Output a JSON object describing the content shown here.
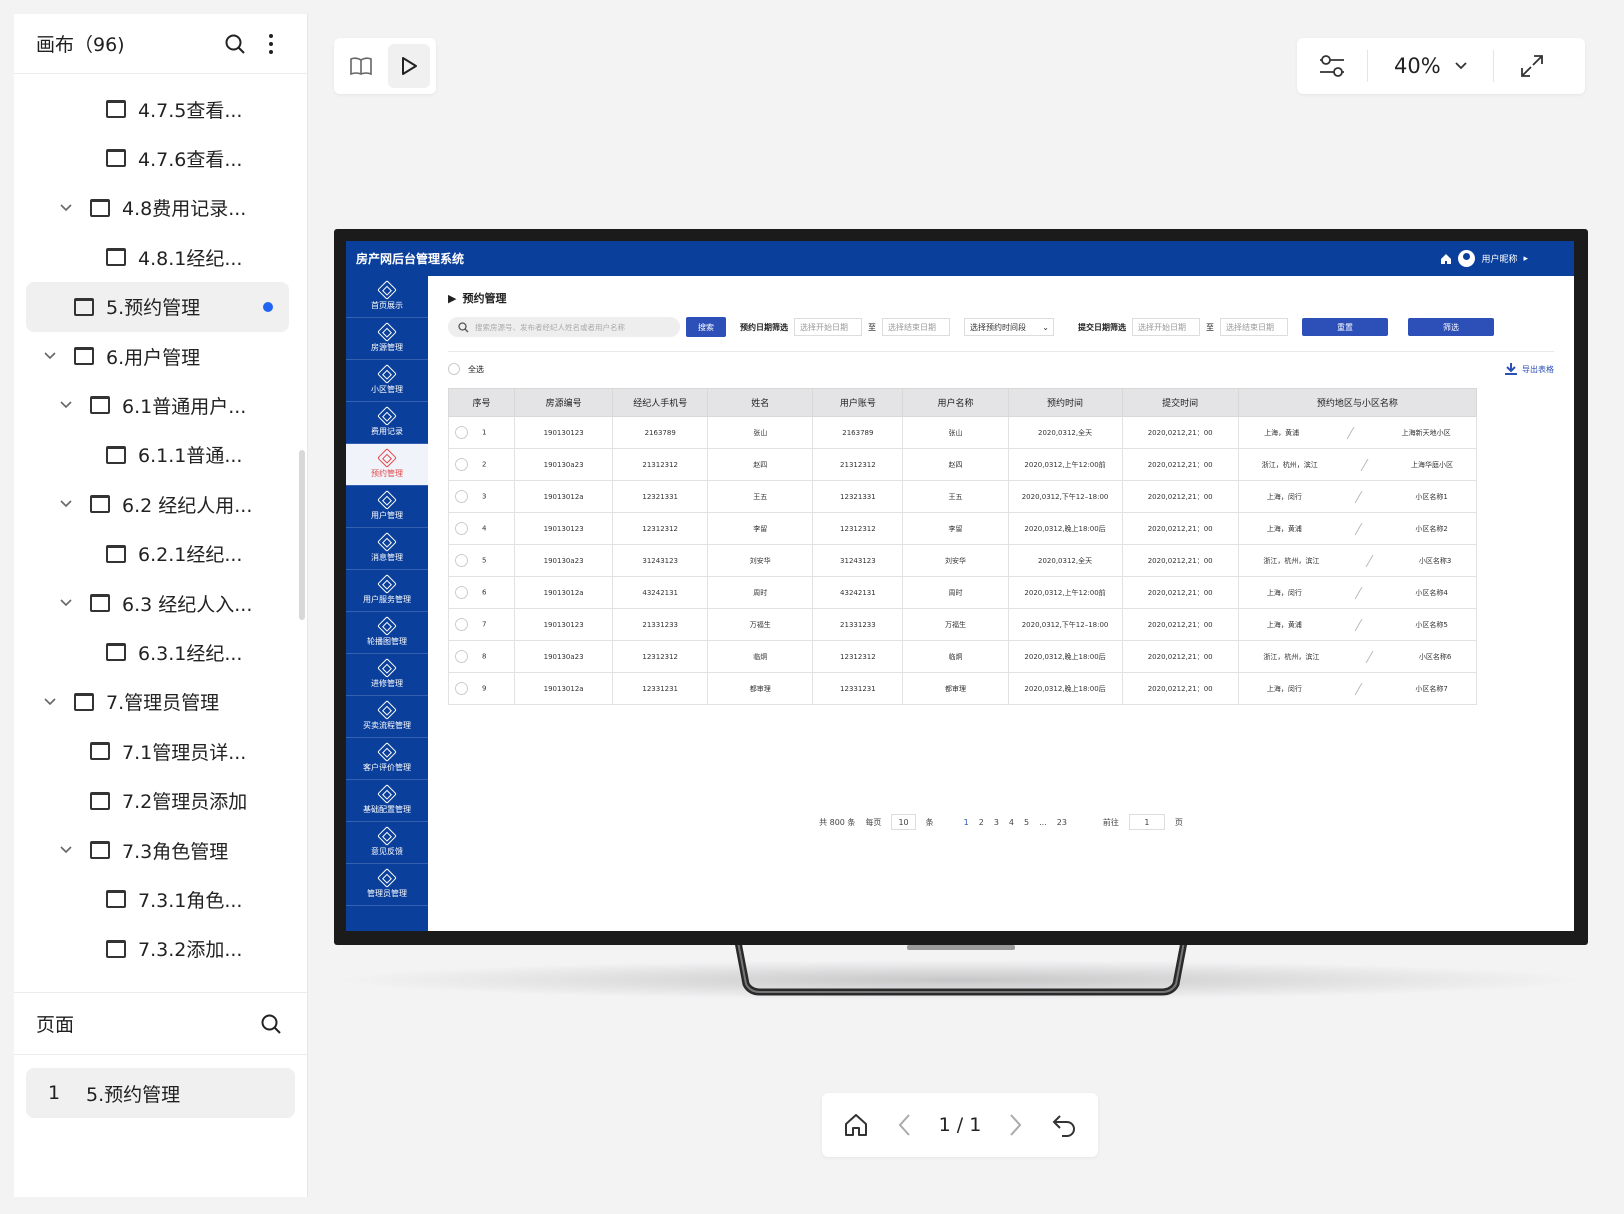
{
  "canvas": {
    "title": "画布（96)"
  },
  "tree": [
    {
      "label": "4.7.5查看...",
      "indent": 2,
      "chevron": false,
      "active": false
    },
    {
      "label": "4.7.6查看...",
      "indent": 2,
      "chevron": false,
      "active": false
    },
    {
      "label": "4.8费用记录...",
      "indent": 1,
      "chevron": true,
      "active": false
    },
    {
      "label": "4.8.1经纪...",
      "indent": 2,
      "chevron": false,
      "active": false
    },
    {
      "label": "5.预约管理",
      "indent": 0,
      "chevron": false,
      "active": true
    },
    {
      "label": "6.用户管理",
      "indent": 0,
      "chevron": true,
      "active": false
    },
    {
      "label": "6.1普通用户...",
      "indent": 1,
      "chevron": true,
      "active": false
    },
    {
      "label": "6.1.1普通...",
      "indent": 2,
      "chevron": false,
      "active": false
    },
    {
      "label": "6.2 经纪人用...",
      "indent": 1,
      "chevron": true,
      "active": false
    },
    {
      "label": "6.2.1经纪...",
      "indent": 2,
      "chevron": false,
      "active": false
    },
    {
      "label": "6.3 经纪人入...",
      "indent": 1,
      "chevron": true,
      "active": false
    },
    {
      "label": "6.3.1经纪...",
      "indent": 2,
      "chevron": false,
      "active": false
    },
    {
      "label": "7.管理员管理",
      "indent": 0,
      "chevron": true,
      "active": false
    },
    {
      "label": "7.1管理员详...",
      "indent": 1,
      "chevron": false,
      "active": false
    },
    {
      "label": "7.2管理员添加",
      "indent": 1,
      "chevron": false,
      "active": false
    },
    {
      "label": "7.3角色管理",
      "indent": 1,
      "chevron": true,
      "active": false
    },
    {
      "label": "7.3.1角色...",
      "indent": 2,
      "chevron": false,
      "active": false
    },
    {
      "label": "7.3.2添加...",
      "indent": 2,
      "chevron": false,
      "active": false
    }
  ],
  "pages": {
    "title": "页面",
    "items": [
      {
        "num": "1",
        "label": "5.预约管理"
      }
    ]
  },
  "toolbar": {
    "zoom": "40%"
  },
  "pager_nav": {
    "text": "1 / 1"
  },
  "app": {
    "title": "房产网后台管理系统",
    "user": "用户昵称",
    "nav": [
      "首页展示",
      "房源管理",
      "小区管理",
      "费用记录",
      "预约管理",
      "用户管理",
      "消息管理",
      "用户服务管理",
      "轮播图管理",
      "进修管理",
      "买卖流程管理",
      "客户评价管理",
      "基础配置管理",
      "意见反馈",
      "管理员管理"
    ],
    "active_nav": 4,
    "page_title": "预约管理",
    "search_placeholder": "搜索房源号、发布者经纪人姓名或者用户名称",
    "search_btn": "搜索",
    "date_filter_label": "预约日期筛选",
    "start_date": "选择开始日期",
    "end_date": "选择结束日期",
    "to": "至",
    "period_select": "选择预约时间段",
    "submit_filter_label": "提交日期筛选",
    "reset_btn": "重置",
    "filter_btn": "筛选",
    "select_all": "全选",
    "export": "导出表格",
    "columns": [
      "序号",
      "房源编号",
      "经纪人手机号",
      "姓名",
      "用户账号",
      "用户名称",
      "预约时间",
      "提交时间",
      "预约地区与小区名称"
    ],
    "rows": [
      [
        "1",
        "190130123",
        "2163789",
        "张山",
        "2163789",
        "张山",
        "2020,0312,全天",
        "2020,0212,21：00",
        "上海，黄浦",
        "上海新天地小区"
      ],
      [
        "2",
        "190130a23",
        "21312312",
        "赵四",
        "21312312",
        "赵四",
        "2020,0312,上午12:00前",
        "2020,0212,21：00",
        "浙江，杭州，滨江",
        "上海华庭小区"
      ],
      [
        "3",
        "19013012a",
        "12321331",
        "王五",
        "12321331",
        "王五",
        "2020,0312,下午12–18:00",
        "2020,0212,21：00",
        "上海，闵行",
        "小区名称1"
      ],
      [
        "4",
        "190130123",
        "12312312",
        "李留",
        "12312312",
        "李留",
        "2020,0312,晚上18:00后",
        "2020,0212,21：00",
        "上海，黄浦",
        "小区名称2"
      ],
      [
        "5",
        "190130a23",
        "31243123",
        "刘安华",
        "31243123",
        "刘安华",
        "2020,0312,全天",
        "2020,0212,21：00",
        "浙江，杭州，滨江",
        "小区名称3"
      ],
      [
        "6",
        "19013012a",
        "43242131",
        "周时",
        "43242131",
        "周时",
        "2020,0312,上午12:00前",
        "2020,0212,21：00",
        "上海，闵行",
        "小区名称4"
      ],
      [
        "7",
        "190130123",
        "21331233",
        "万福生",
        "21331233",
        "万福生",
        "2020,0312,下午12–18:00",
        "2020,0212,21：00",
        "上海，黄浦",
        "小区名称5"
      ],
      [
        "8",
        "190130a23",
        "12312312",
        "临炯",
        "12312312",
        "临炯",
        "2020,0312,晚上18:00后",
        "2020,0212,21：00",
        "浙江，杭州，滨江",
        "小区名称6"
      ],
      [
        "9",
        "19013012a",
        "12331231",
        "都审理",
        "12331231",
        "都审理",
        "2020,0312,晚上18:00后",
        "2020,0212,21：00",
        "上海，闵行",
        "小区名称7"
      ]
    ],
    "pager": {
      "total": "共 800 条",
      "per_page_label": "每页",
      "per_page": "10",
      "unit": "条",
      "pages": [
        "1",
        "2",
        "3",
        "4",
        "5",
        "...",
        "23"
      ],
      "goto_label": "前往",
      "goto_value": "1",
      "page_unit": "页"
    }
  },
  "colors": {
    "brand_blue": "#0a3f9c",
    "button_blue": "#2c4fb8",
    "active_dot": "#2164f3",
    "nav_active_text": "#e04a4a"
  }
}
